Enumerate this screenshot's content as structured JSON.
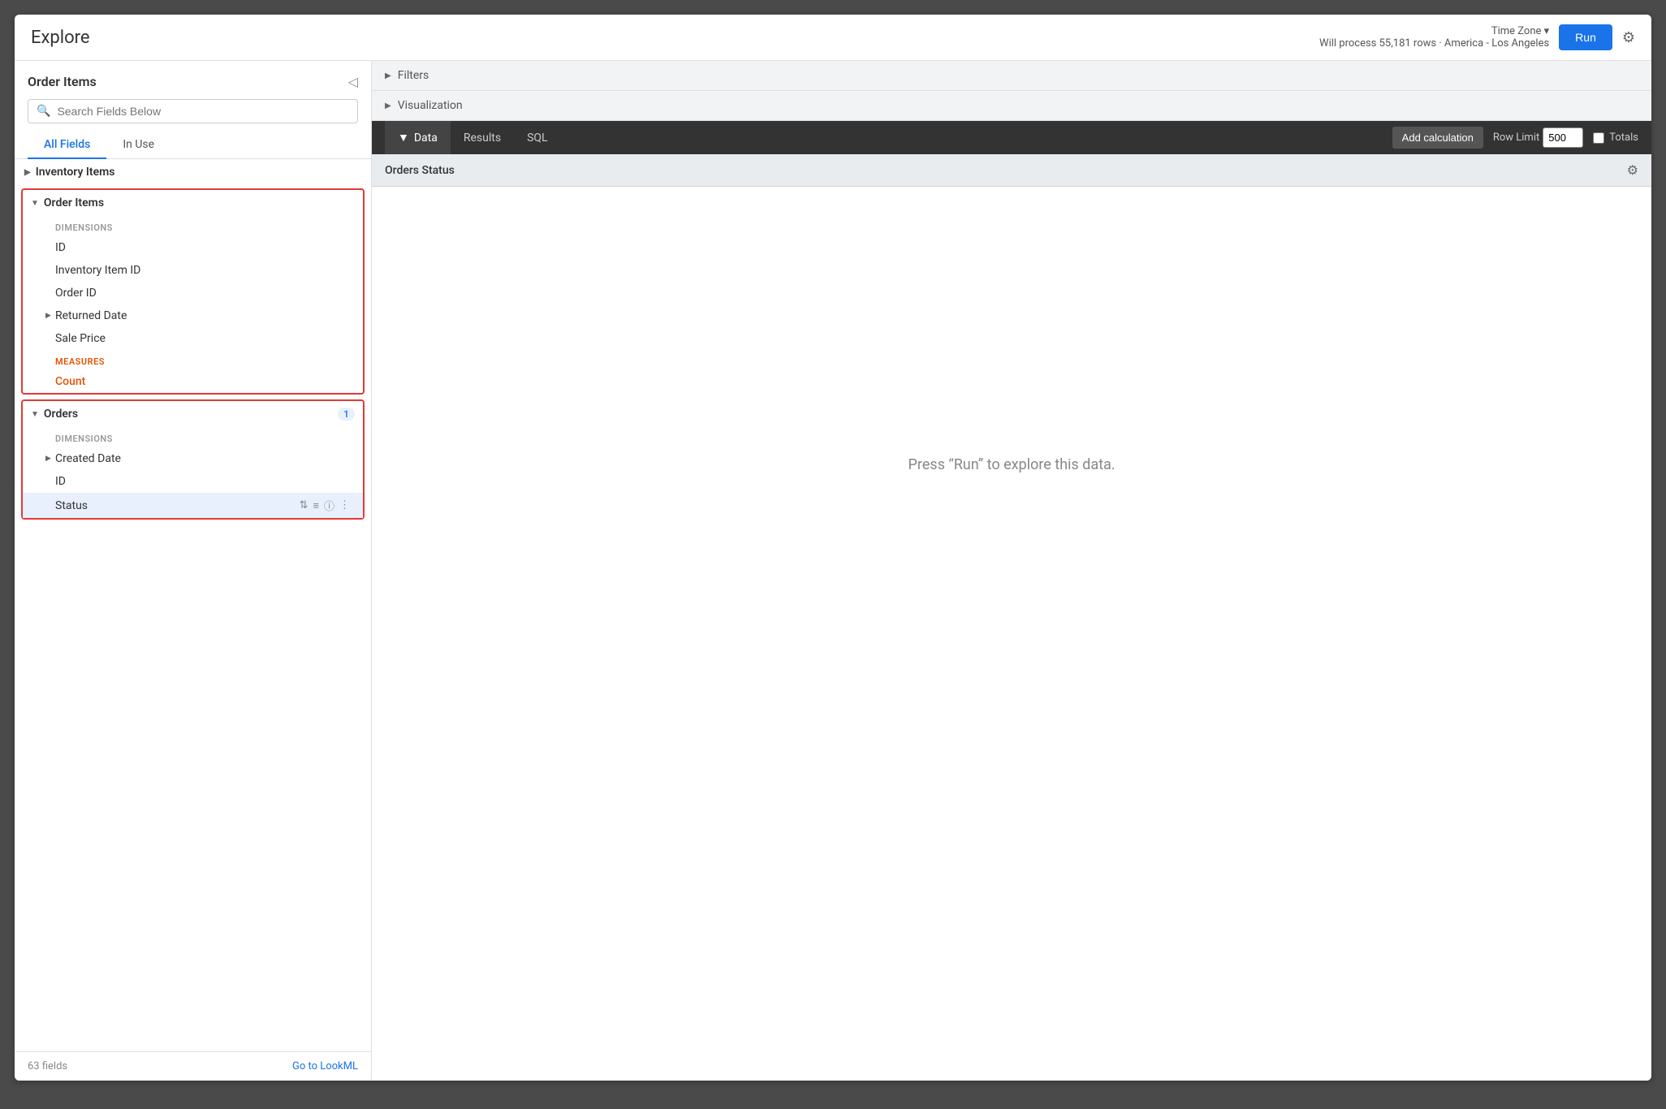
{
  "header": {
    "title": "Explore",
    "timezone_label": "Time Zone",
    "timezone_chevron": "▾",
    "rows_info": "Will process 55,181 rows · America - Los Angeles",
    "run_button": "Run"
  },
  "sidebar": {
    "title": "Order Items",
    "search_placeholder": "Search Fields Below",
    "tabs": [
      {
        "label": "All Fields",
        "active": true
      },
      {
        "label": "In Use",
        "active": false
      }
    ],
    "groups": [
      {
        "name": "Inventory Items",
        "expanded": false,
        "red_border": false,
        "badge": null,
        "sections": []
      },
      {
        "name": "Order Items",
        "expanded": true,
        "red_border": true,
        "badge": null,
        "sections": [
          {
            "label": "DIMENSIONS",
            "fields": [
              {
                "name": "ID",
                "type": "dimension",
                "has_chevron": false
              },
              {
                "name": "Inventory Item ID",
                "type": "dimension",
                "has_chevron": false
              },
              {
                "name": "Order ID",
                "type": "dimension",
                "has_chevron": false
              },
              {
                "name": "Returned Date",
                "type": "dimension",
                "has_chevron": true
              },
              {
                "name": "Sale Price",
                "type": "dimension",
                "has_chevron": false
              }
            ]
          },
          {
            "label": "MEASURES",
            "fields": [
              {
                "name": "Count",
                "type": "measure",
                "has_chevron": false
              }
            ]
          }
        ]
      },
      {
        "name": "Orders",
        "expanded": true,
        "red_border": true,
        "badge": "1",
        "sections": [
          {
            "label": "DIMENSIONS",
            "fields": [
              {
                "name": "Created Date",
                "type": "dimension",
                "has_chevron": true
              },
              {
                "name": "ID",
                "type": "dimension",
                "has_chevron": false
              },
              {
                "name": "Status",
                "type": "dimension",
                "has_chevron": false,
                "highlighted": true
              }
            ]
          }
        ]
      }
    ],
    "footer": {
      "fields_count": "63 fields",
      "go_to_lookml": "Go to LookML"
    }
  },
  "right_panel": {
    "filters_label": "Filters",
    "visualization_label": "Visualization",
    "toolbar": {
      "tabs": [
        {
          "label": "Data",
          "active": true,
          "has_arrow": true
        },
        {
          "label": "Results",
          "active": false
        },
        {
          "label": "SQL",
          "active": false
        }
      ],
      "add_calculation": "Add calculation",
      "row_limit_label": "Row Limit",
      "row_limit_value": "500",
      "totals_label": "Totals"
    },
    "data_header": {
      "column": "Orders Status"
    },
    "empty_state": "Press “Run” to explore this data."
  },
  "icons": {
    "chevron_right": "▶",
    "chevron_down": "▼",
    "chevron_left": "◀",
    "search": "🔍",
    "gear": "⚙",
    "sort": "⇅",
    "filter": "≡",
    "info": "ⓘ",
    "more": "⋮"
  }
}
